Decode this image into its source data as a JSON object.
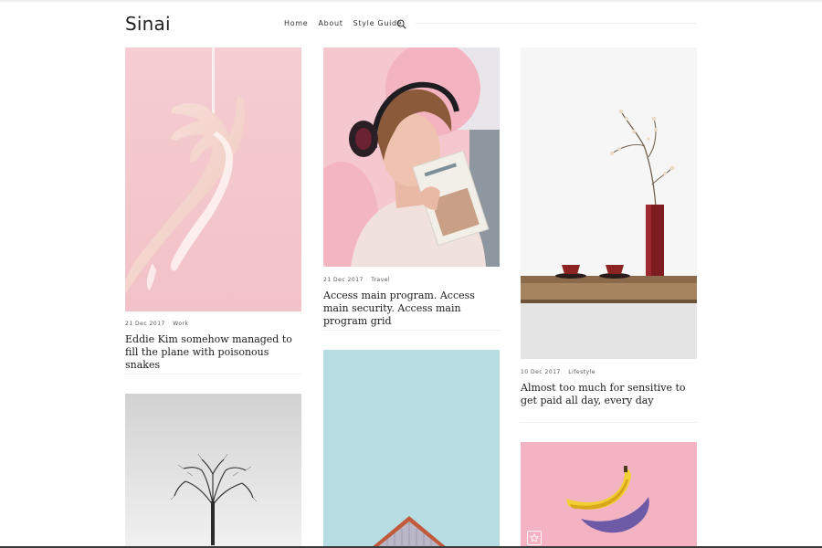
{
  "site": {
    "title": "Sinai"
  },
  "nav": {
    "items": [
      {
        "label": "Home"
      },
      {
        "label": "About"
      },
      {
        "label": "Style Guide"
      }
    ],
    "search_icon": "search-icon"
  },
  "posts": [
    {
      "date": "21 Dec 2017",
      "category": "Work",
      "title": "Eddie Kim somehow managed to fill the plane with poisonous snakes",
      "image": "pink-hand-milk"
    },
    {
      "date": "21 Dec 2017",
      "category": "Travel",
      "title": "Access main program. Access main security. Access main program grid",
      "image": "woman-headphones-book"
    },
    {
      "date": "10 Dec 2017",
      "category": "Lifestyle",
      "title": "Almost too much for sensitive to get paid all day, every day",
      "image": "vase-teacups-shelf"
    },
    {
      "image": "bare-tree-snow"
    },
    {
      "image": "roof-sky"
    },
    {
      "image": "banana-pink",
      "badge_icon": "star-icon"
    }
  ],
  "colors": {
    "pink_bg": "#f4c6cc",
    "pink_light": "#f7d4d9",
    "sky": "#b3dbe0",
    "banana_bg": "#f4b2c2",
    "text_dark": "#1b1b1b"
  }
}
